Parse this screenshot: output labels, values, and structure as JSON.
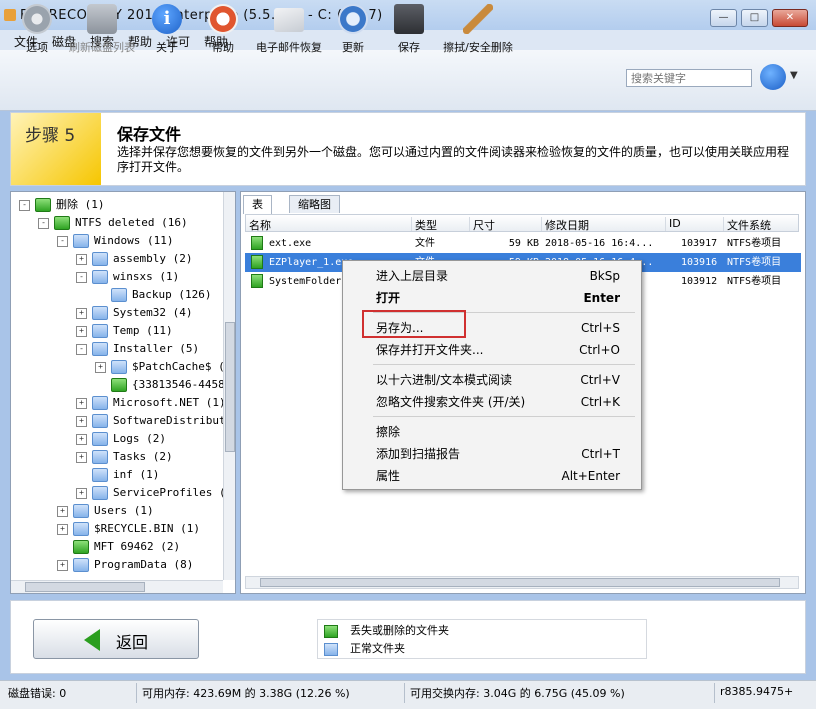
{
  "window": {
    "title": "FILERECOVERY 2016 Enterprise (5.5.9.7) - C: (Win7)"
  },
  "menu": [
    "文件",
    "磁盘",
    "搜索",
    "帮助",
    "许可",
    "帮助"
  ],
  "toolbar": [
    {
      "label": "选项",
      "icon": "gear-icon",
      "color": "#9aa3ad",
      "enabled": true
    },
    {
      "label": "刷新磁盘列表",
      "icon": "disk-icon",
      "color": "#9aa3ad",
      "enabled": false
    },
    {
      "label": "关于",
      "icon": "info-icon",
      "color": "#1f63c9",
      "enabled": true
    },
    {
      "label": "帮助",
      "icon": "lifebuoy-icon",
      "color": "#e0552f",
      "enabled": true
    },
    {
      "label": "电子邮件恢复",
      "icon": "envelope-icon",
      "color": "#c7ccd3",
      "enabled": true
    },
    {
      "label": "更新",
      "icon": "refresh-icon",
      "color": "#3b78c9",
      "enabled": true
    },
    {
      "label": "保存",
      "icon": "floppy-icon",
      "color": "#3d3f44",
      "enabled": true
    },
    {
      "label": "擦拭/安全删除",
      "icon": "broom-icon",
      "color": "#c98a3c",
      "enabled": true
    }
  ],
  "search": {
    "placeholder": "搜索关键字"
  },
  "step": {
    "label": "步骤 5",
    "title": "保存文件",
    "description": "选择并保存您想要恢复的文件到另外一个磁盘。您可以通过内置的文件阅读器来检验恢复的文件的质量，也可以使用关联应用程序打开文件。"
  },
  "tree": [
    {
      "label": "删除 (1)",
      "depth": 0,
      "expander": "-",
      "color": "green"
    },
    {
      "label": "NTFS deleted (16)",
      "depth": 1,
      "expander": "-",
      "color": "green"
    },
    {
      "label": "Windows (11)",
      "depth": 2,
      "expander": "-",
      "color": "blue"
    },
    {
      "label": "assembly (2)",
      "depth": 3,
      "expander": "+",
      "color": "blue"
    },
    {
      "label": "winsxs (1)",
      "depth": 3,
      "expander": "-",
      "color": "blue"
    },
    {
      "label": "Backup (126)",
      "depth": 4,
      "expander": "",
      "color": "blue"
    },
    {
      "label": "System32 (4)",
      "depth": 3,
      "expander": "+",
      "color": "blue"
    },
    {
      "label": "Temp (11)",
      "depth": 3,
      "expander": "+",
      "color": "blue"
    },
    {
      "label": "Installer (5)",
      "depth": 3,
      "expander": "-",
      "color": "blue"
    },
    {
      "label": "$PatchCache$ (1",
      "depth": 4,
      "expander": "+",
      "color": "blue"
    },
    {
      "label": "{33813546-4458-",
      "depth": 4,
      "expander": "",
      "color": "green"
    },
    {
      "label": "Microsoft.NET (1)",
      "depth": 3,
      "expander": "+",
      "color": "blue"
    },
    {
      "label": "SoftwareDistributi",
      "depth": 3,
      "expander": "+",
      "color": "blue"
    },
    {
      "label": "Logs (2)",
      "depth": 3,
      "expander": "+",
      "color": "blue"
    },
    {
      "label": "Tasks (2)",
      "depth": 3,
      "expander": "+",
      "color": "blue"
    },
    {
      "label": "inf (1)",
      "depth": 3,
      "expander": "",
      "color": "blue"
    },
    {
      "label": "ServiceProfiles (1",
      "depth": 3,
      "expander": "+",
      "color": "blue"
    },
    {
      "label": "Users (1)",
      "depth": 2,
      "expander": "+",
      "color": "blue"
    },
    {
      "label": "$RECYCLE.BIN (1)",
      "depth": 2,
      "expander": "+",
      "color": "blue"
    },
    {
      "label": "MFT 69462 (2)",
      "depth": 2,
      "expander": "",
      "color": "green"
    },
    {
      "label": "ProgramData (8)",
      "depth": 2,
      "expander": "+",
      "color": "blue"
    }
  ],
  "tabs": [
    "表",
    "缩略图"
  ],
  "columns": [
    "名称",
    "类型",
    "尺寸",
    "修改日期",
    "ID",
    "文件系统"
  ],
  "files": [
    {
      "name": "ext.exe",
      "type": "文件",
      "size": "59 KB",
      "date": "2018-05-16 16:4...",
      "id": "103917",
      "fs": "NTFS卷项目",
      "selected": false
    },
    {
      "name": "EZPlayer_1.exe",
      "type": "文件",
      "size": "59 KB",
      "date": "2018-05-16 16:4...",
      "id": "103916",
      "fs": "NTFS卷项目",
      "selected": true
    },
    {
      "name": "SystemFolder",
      "type": "文件",
      "size": "",
      "date": "",
      "id": "103912",
      "fs": "NTFS卷项目",
      "selected": false
    }
  ],
  "context_menu": [
    {
      "label": "进入上层目录",
      "shortcut": "BkSp",
      "bold": false
    },
    {
      "label": "打开",
      "shortcut": "Enter",
      "bold": true
    },
    {
      "sep": true
    },
    {
      "label": "另存为...",
      "shortcut": "Ctrl+S",
      "bold": false,
      "highlight": true
    },
    {
      "label": "保存并打开文件夹...",
      "shortcut": "Ctrl+O",
      "bold": false
    },
    {
      "sep": true
    },
    {
      "label": "以十六进制/文本模式阅读",
      "shortcut": "Ctrl+V",
      "bold": false
    },
    {
      "label": "忽略文件搜索文件夹 (开/关)",
      "shortcut": "Ctrl+K",
      "bold": false
    },
    {
      "sep": true
    },
    {
      "label": "擦除",
      "shortcut": "",
      "bold": false
    },
    {
      "label": "添加到扫描报告",
      "shortcut": "Ctrl+T",
      "bold": false
    },
    {
      "label": "属性",
      "shortcut": "Alt+Enter",
      "bold": false
    }
  ],
  "bottom": {
    "back_label": "返回",
    "legend": [
      {
        "label": "丢失或删除的文件夹",
        "color": "green"
      },
      {
        "label": "正常文件夹",
        "color": "blue"
      }
    ]
  },
  "status": {
    "disk_errors": "磁盘错误: 0",
    "memory": "可用内存: 423.69M 的 3.38G (12.26 %)",
    "swap": "可用交换内存: 3.04G 的 6.75G (45.09 %)",
    "right": "r8385.9475+"
  }
}
